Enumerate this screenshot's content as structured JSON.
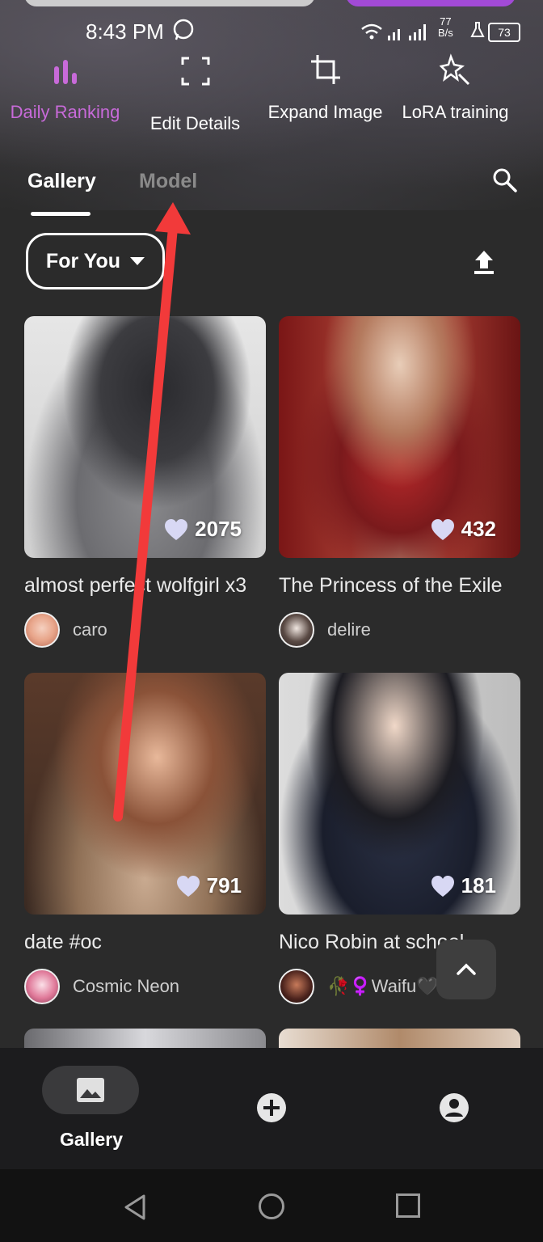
{
  "status": {
    "time": "8:43 PM",
    "net_speed_value": "77",
    "net_speed_unit": "B/s",
    "battery": "73"
  },
  "quick_actions": [
    {
      "label": "Daily Ranking",
      "icon": "bar-chart-icon",
      "active": true
    },
    {
      "label": "Edit Details",
      "icon": "focus-frame-icon",
      "active": false
    },
    {
      "label": "Expand Image",
      "icon": "crop-icon",
      "active": false
    },
    {
      "label": "LoRA training",
      "icon": "magic-star-icon",
      "active": false
    }
  ],
  "tabs": {
    "gallery": "Gallery",
    "model": "Model",
    "active": "gallery"
  },
  "filter": {
    "label": "For You"
  },
  "cards": [
    {
      "title": "almost perfect wolfgirl x3",
      "likes": "2075",
      "author": "caro"
    },
    {
      "title": "The Princess of the Exile",
      "likes": "432",
      "author": "delire"
    },
    {
      "title": "date #oc",
      "likes": "791",
      "author": "Cosmic Neon"
    },
    {
      "title": "Nico Robin at school",
      "likes": "181",
      "author": "🥀♀️Waifu🖤"
    }
  ],
  "bottom_nav": {
    "gallery_label": "Gallery"
  },
  "colors": {
    "accent": "#c86ad9",
    "background": "#2b2b2b",
    "annotation_arrow": "#f23a3a"
  }
}
